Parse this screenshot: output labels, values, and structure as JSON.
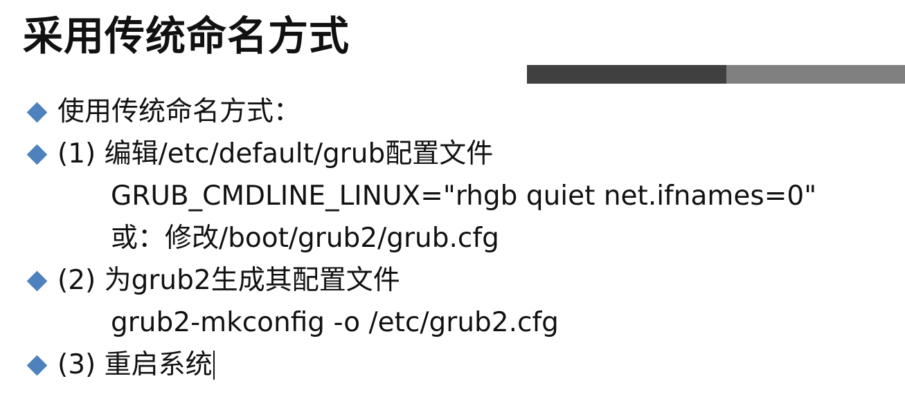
{
  "slide": {
    "title": "采用传统命名方式",
    "bullets": [
      {
        "text": "使用传统命名方式："
      },
      {
        "text": "(1) 编辑/etc/default/grub配置文件"
      },
      {
        "text": "(2) 为grub2生成其配置文件"
      },
      {
        "text": "(3) 重启系统"
      }
    ],
    "sub_lines": [
      {
        "text": "GRUB_CMDLINE_LINUX=\"rhgb quiet net.ifnames=0\""
      },
      {
        "text": "或：修改/boot/grub2/grub.cfg"
      },
      {
        "text": "grub2-mkconfig -o /etc/grub2.cfg"
      }
    ]
  },
  "colors": {
    "bullet": "#4f81bd",
    "bar_dark": "#404040",
    "bar_light": "#808080",
    "text": "#111111"
  },
  "icons": {
    "bullet": "diamond-bullet-icon"
  }
}
